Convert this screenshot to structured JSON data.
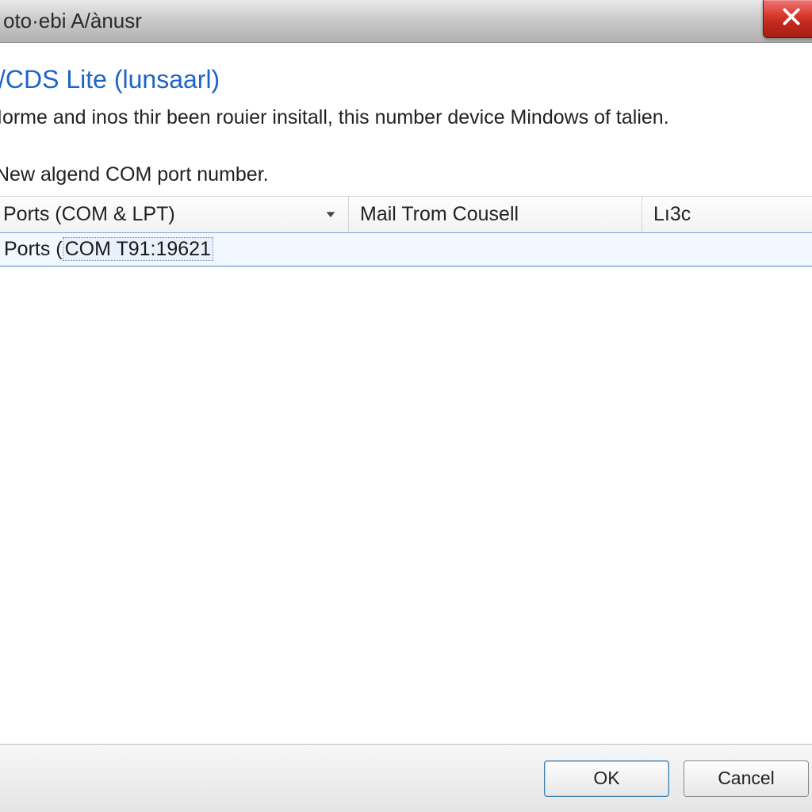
{
  "window": {
    "title": "oto·ebi A/ànusr"
  },
  "main": {
    "heading": "/CDS Lite (lunsaarl)",
    "description": "Iorme and inos thir been rouier insitall, this number device Mindows of talien.",
    "subheading": "New algend COM port number.",
    "columns": [
      {
        "label": "Ports (COM & LPT)"
      },
      {
        "label": "Mail Trom Cousell"
      },
      {
        "label": "Lı3c"
      }
    ],
    "rows": [
      {
        "label_prefix": "Ports (",
        "label_value": "COM T91:19621"
      }
    ]
  },
  "footer": {
    "ok_label": "OK",
    "cancel_label": "Cancel"
  }
}
